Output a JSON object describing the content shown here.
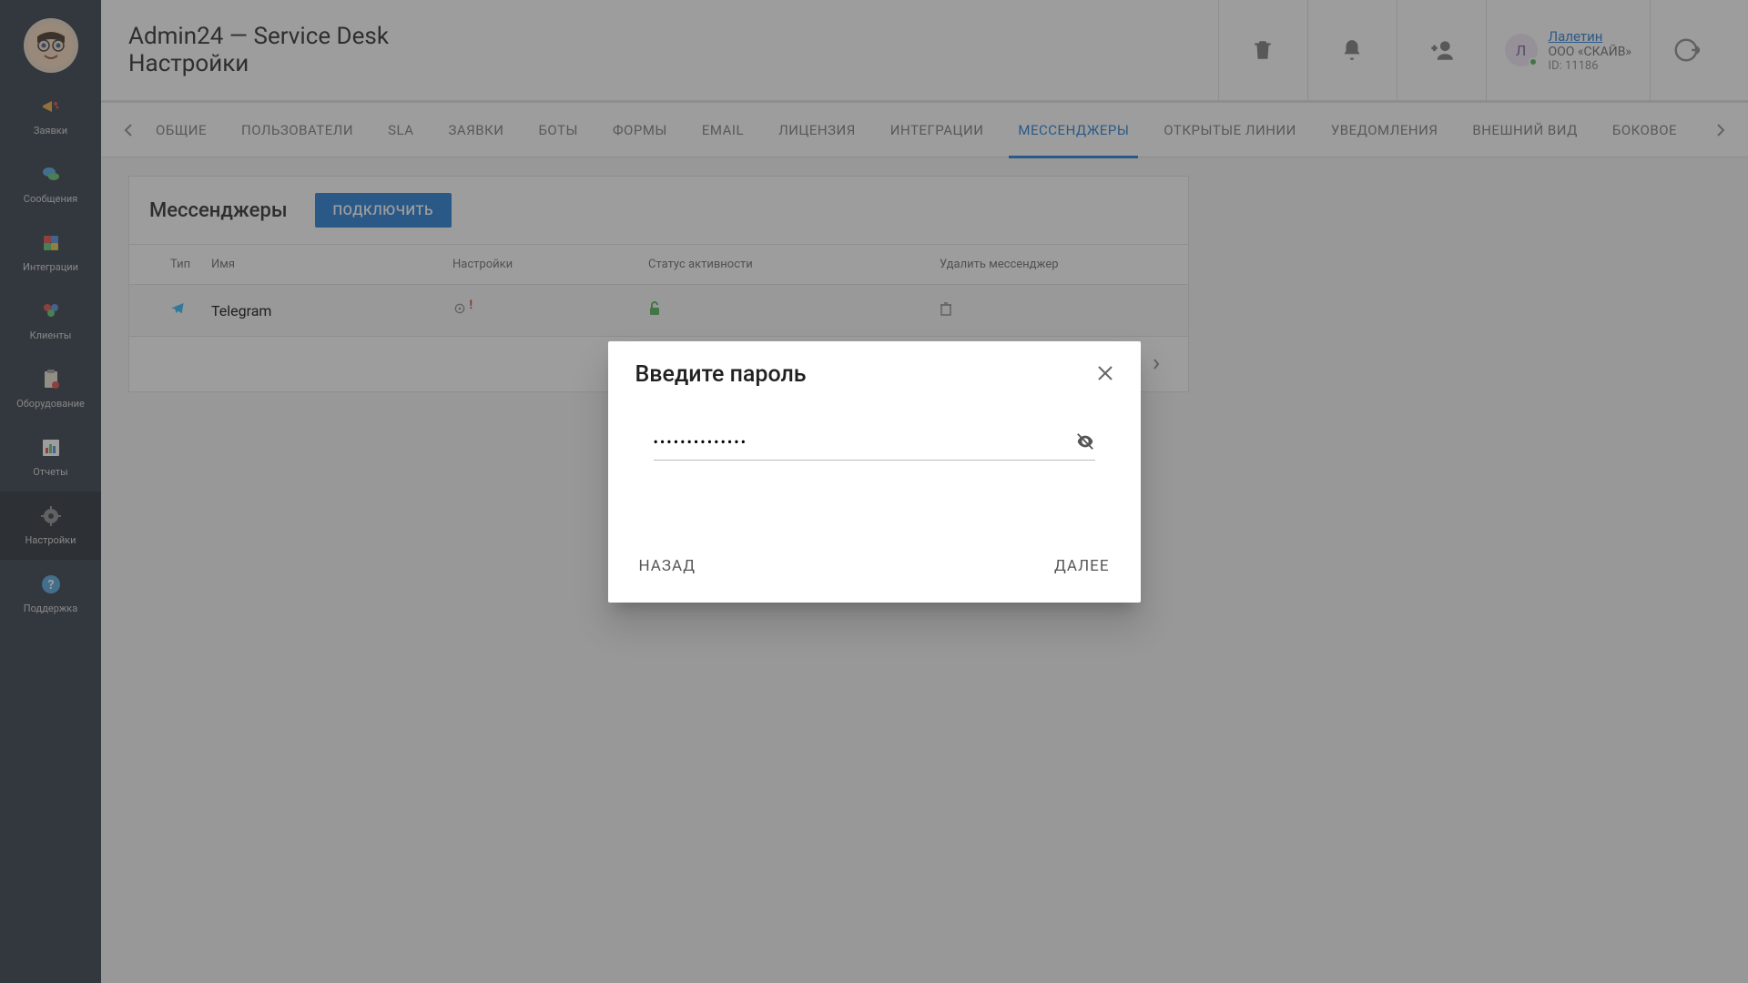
{
  "sidebar": {
    "items": [
      {
        "label": "Заявки"
      },
      {
        "label": "Сообщения"
      },
      {
        "label": "Интеграции"
      },
      {
        "label": "Клиенты"
      },
      {
        "label": "Оборудование"
      },
      {
        "label": "Отчеты"
      },
      {
        "label": "Настройки"
      },
      {
        "label": "Поддержка"
      }
    ]
  },
  "header": {
    "title": "Admin24 — Service Desk",
    "subtitle": "Настройки",
    "user": {
      "initial": "Л",
      "name": "Лалетин",
      "org": "ООО «СКАЙВ»",
      "id": "ID: 11186"
    }
  },
  "tabs": [
    "ОБЩИЕ",
    "ПОЛЬЗОВАТЕЛИ",
    "SLA",
    "ЗАЯВКИ",
    "БОТЫ",
    "ФОРМЫ",
    "EMAIL",
    "ЛИЦЕНЗИЯ",
    "ИНТЕГРАЦИИ",
    "МЕССЕНДЖЕРЫ",
    "ОТКРЫТЫЕ ЛИНИИ",
    "УВЕДОМЛЕНИЯ",
    "ВНЕШНИЙ ВИД",
    "БОКОВОЕ"
  ],
  "active_tab_index": 9,
  "panel": {
    "title": "Мессенджеры",
    "connect_btn": "ПОДКЛЮЧИТЬ",
    "columns": [
      "Тип",
      "Имя",
      "Настройки",
      "Статус активности",
      "Удалить мессенджер"
    ],
    "rows": [
      {
        "name": "Telegram"
      }
    ]
  },
  "modal": {
    "title": "Введите пароль",
    "password_value": "••••••••••••••",
    "back_btn": "НАЗАД",
    "next_btn": "ДАЛЕЕ"
  }
}
